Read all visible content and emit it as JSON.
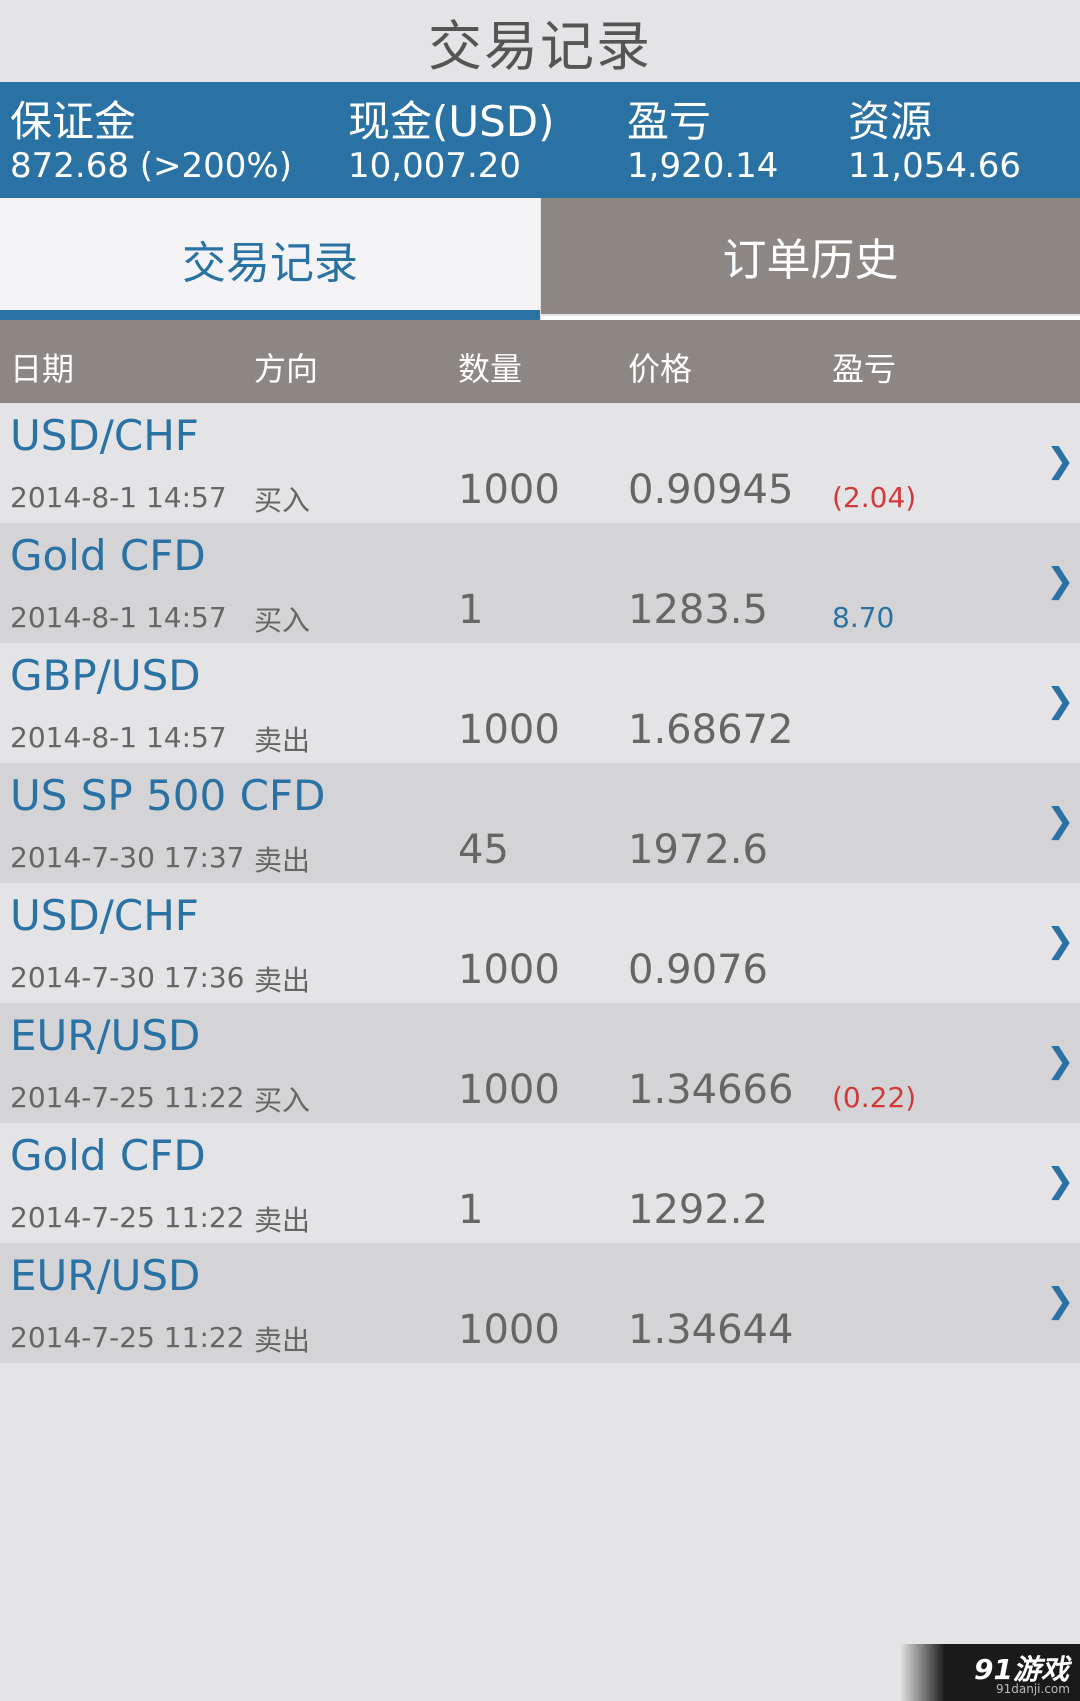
{
  "page": {
    "title": "交易记录"
  },
  "summary": [
    {
      "label": "保证金",
      "value": "872.68  (>200%)"
    },
    {
      "label": "现金(USD)",
      "value": "10,007.20"
    },
    {
      "label": "盈亏",
      "value": "1,920.14"
    },
    {
      "label": "资源",
      "value": "11,054.66"
    }
  ],
  "tabs": {
    "active": "交易记录",
    "inactive": "订单历史"
  },
  "columns": {
    "date": "日期",
    "direction": "方向",
    "quantity": "数量",
    "price": "价格",
    "pl": "盈亏"
  },
  "rows": [
    {
      "instrument": "USD/CHF",
      "date": "2014-8-1 14:57",
      "direction": "买入",
      "quantity": "1000",
      "price": "0.90945",
      "pl": "(2.04)",
      "pl_sign": "neg"
    },
    {
      "instrument": "Gold CFD",
      "date": "2014-8-1 14:57",
      "direction": "买入",
      "quantity": "1",
      "price": "1283.5",
      "pl": "8.70",
      "pl_sign": "pos"
    },
    {
      "instrument": "GBP/USD",
      "date": "2014-8-1 14:57",
      "direction": "卖出",
      "quantity": "1000",
      "price": "1.68672",
      "pl": "",
      "pl_sign": ""
    },
    {
      "instrument": "US SP 500 CFD",
      "date": "2014-7-30 17:37",
      "direction": "卖出",
      "quantity": "45",
      "price": "1972.6",
      "pl": "",
      "pl_sign": ""
    },
    {
      "instrument": "USD/CHF",
      "date": "2014-7-30 17:36",
      "direction": "卖出",
      "quantity": "1000",
      "price": "0.9076",
      "pl": "",
      "pl_sign": ""
    },
    {
      "instrument": "EUR/USD",
      "date": "2014-7-25 11:22",
      "direction": "买入",
      "quantity": "1000",
      "price": "1.34666",
      "pl": "(0.22)",
      "pl_sign": "neg"
    },
    {
      "instrument": "Gold CFD",
      "date": "2014-7-25 11:22",
      "direction": "卖出",
      "quantity": "1",
      "price": "1292.2",
      "pl": "",
      "pl_sign": ""
    },
    {
      "instrument": "EUR/USD",
      "date": "2014-7-25 11:22",
      "direction": "卖出",
      "quantity": "1000",
      "price": "1.34644",
      "pl": "",
      "pl_sign": ""
    }
  ],
  "icons": {
    "row_chevron": "chevron-right-icon",
    "chevron_glyph": "❯"
  },
  "colors": {
    "accent": "#2b72a4",
    "header_gray": "#8c8782",
    "negative": "#d2393b",
    "background": "#e4e4e6"
  },
  "watermark": {
    "main": "91游戏",
    "sub": "91danji.com"
  }
}
